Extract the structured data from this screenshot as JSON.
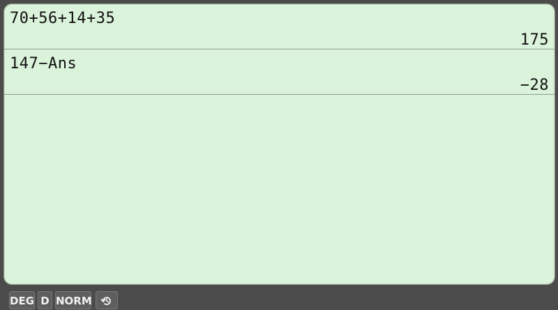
{
  "history": [
    {
      "expression": "70+56+14+35",
      "result": "175"
    },
    {
      "expression": "147−Ans",
      "result": "−28"
    }
  ],
  "status_bar": {
    "angle_mode": "DEG",
    "display_mode": "D",
    "number_format": "NORM",
    "history_icon": "history-icon"
  },
  "colors": {
    "display_background": "#dbf2db",
    "frame_background": "#4b4b4b"
  }
}
